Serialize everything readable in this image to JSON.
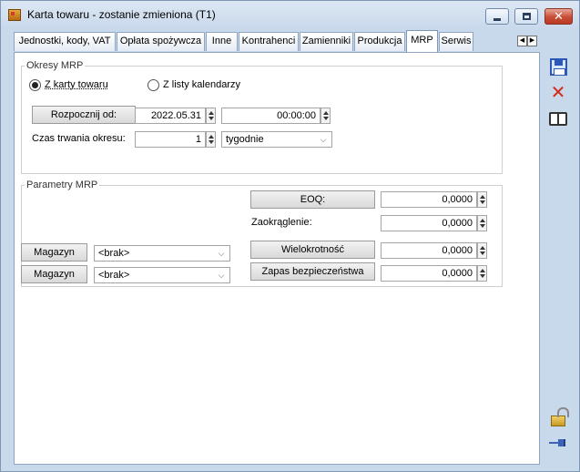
{
  "window": {
    "title": "Karta towaru - zostanie zmieniona (T1)"
  },
  "tabs": [
    {
      "label": "Jednostki, kody, VAT"
    },
    {
      "label": "Opłata spożywcza"
    },
    {
      "label": "Inne"
    },
    {
      "label": "Kontrahenci"
    },
    {
      "label": "Zamienniki"
    },
    {
      "label": "Produkcja"
    },
    {
      "label": "MRP",
      "active": true
    },
    {
      "label": "Serwis"
    }
  ],
  "okresy": {
    "group_label": "Okresy MRP",
    "radio_karta": "Z karty towaru",
    "radio_karta_checked": true,
    "radio_lista": "Z listy kalendarzy",
    "rozpocznij_label": "Rozpocznij od:",
    "date_value": "2022.05.31",
    "time_value": "00:00:00",
    "czas_label": "Czas trwania okresu:",
    "czas_value": "1",
    "unit_value": "tygodnie"
  },
  "parametry": {
    "group_label": "Parametry MRP",
    "eoq_label": "EOQ:",
    "eoq_value": "0,0000",
    "zaokraglenie_label": "Zaokrąglenie:",
    "zaokraglenie_value": "0,0000",
    "wielokrotnosc_label": "Wielokrotność",
    "wielokrotnosc_value": "0,0000",
    "zapas_label": "Zapas bezpieczeństwa",
    "zapas_value": "0,0000",
    "magazyn1_label": "Magazyn",
    "magazyn1_value": "<brak>",
    "magazyn2_label": "Magazyn",
    "magazyn2_value": "<brak>"
  },
  "icons": {
    "save": "save-icon",
    "cancel": "close-icon",
    "book": "book-icon",
    "lock": "lock-open-icon",
    "pin": "pin-icon"
  },
  "colors": {
    "window_bg": "#c9d9ec",
    "accent_blue": "#2c58b8",
    "cancel_red": "#d52a1a"
  }
}
